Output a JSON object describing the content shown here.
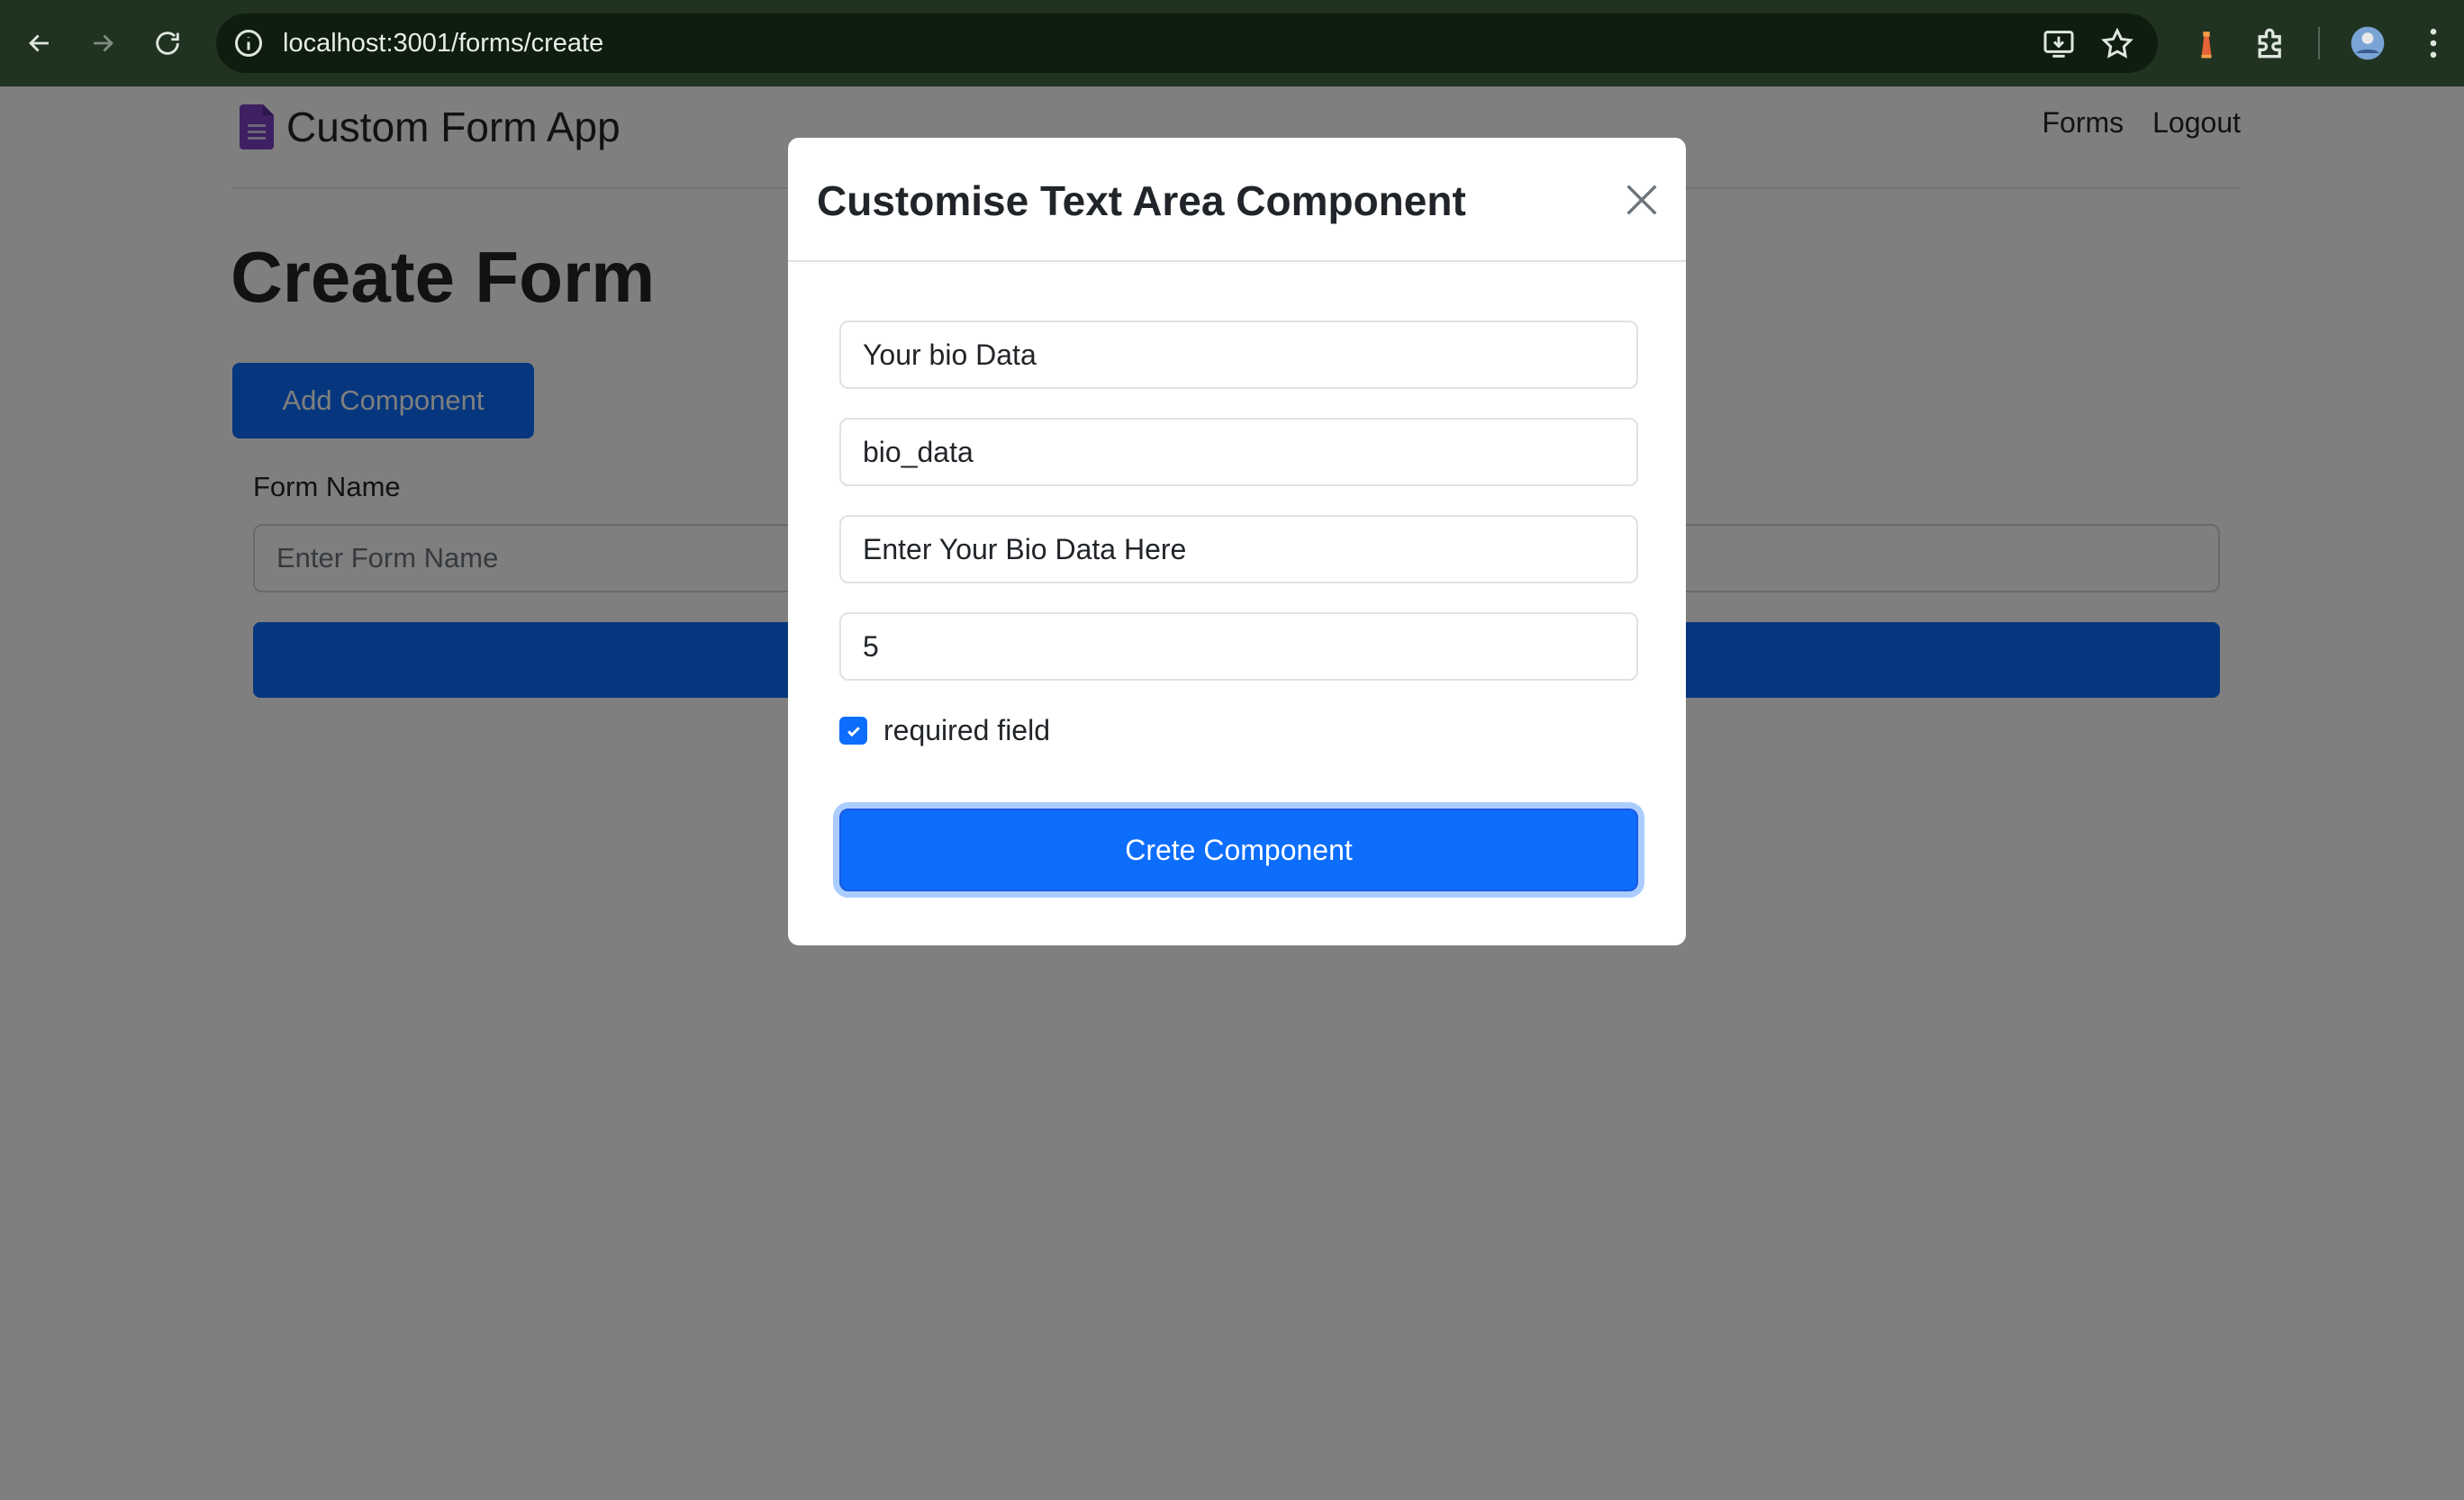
{
  "browser": {
    "url": "localhost:3001/forms/create",
    "back_icon": "arrow-left-icon",
    "forward_icon": "arrow-right-icon",
    "reload_icon": "reload-icon",
    "colors": {
      "toolbar": "#1f3320",
      "omnibox": "#0e1d0f"
    }
  },
  "header": {
    "brand": "Custom Form App",
    "brand_icon": "document-icon",
    "nav": [
      "Forms",
      "Logout"
    ]
  },
  "main": {
    "title": "Create Form",
    "add_button": "Add Component",
    "form_name_label": "Form Name",
    "form_name_placeholder": "Enter Form Name"
  },
  "modal": {
    "title": "Customise Text Area Component",
    "close_icon": "close-icon",
    "fields": {
      "label_value": "Your bio Data",
      "name_value": "bio_data",
      "placeholder_value": "Enter Your Bio Data Here",
      "rows_value": "5"
    },
    "required": {
      "label": "required field",
      "checked": true
    },
    "submit_label": "Crete Component"
  },
  "colors": {
    "primary": "#0d6efd",
    "backdrop": "rgba(0,0,0,0.5)"
  }
}
